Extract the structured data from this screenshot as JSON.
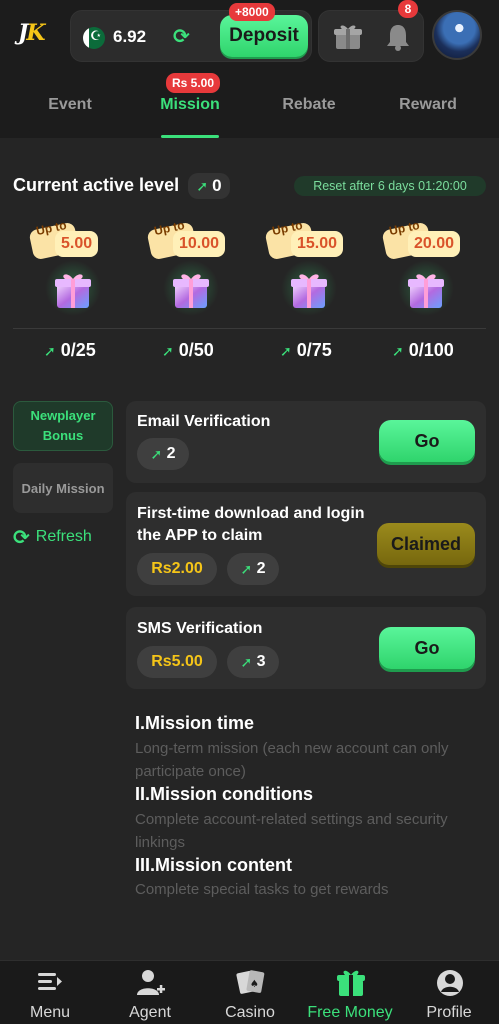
{
  "header": {
    "logo_text_j": "J",
    "logo_text_k": "K",
    "balance": "6.92",
    "deposit_label": "Deposit",
    "deposit_badge": "+8000",
    "notification_count": "8",
    "icons": [
      "pakistan-flag-icon",
      "refresh-icon",
      "gift-icon",
      "bell-icon",
      "avatar"
    ]
  },
  "tabs": {
    "items": [
      {
        "label": "Event"
      },
      {
        "label": "Mission"
      },
      {
        "label": "Rebate"
      },
      {
        "label": "Reward"
      }
    ],
    "active": "Mission",
    "mission_badge": "Rs 5.00"
  },
  "level": {
    "title": "Current active level",
    "value": "0",
    "reset_text": "Reset after 6 days 01:20:00",
    "tiers": [
      {
        "up_to": "Up to",
        "amount": "5.00",
        "progress": "0/25"
      },
      {
        "up_to": "Up to",
        "amount": "10.00",
        "progress": "0/50"
      },
      {
        "up_to": "Up to",
        "amount": "15.00",
        "progress": "0/75"
      },
      {
        "up_to": "Up to",
        "amount": "20.00",
        "progress": "0/100"
      }
    ]
  },
  "sidebar": {
    "newplayer_line1": "Newplayer",
    "newplayer_line2": "Bonus",
    "daily": "Daily Mission",
    "refresh": "Refresh"
  },
  "missions": [
    {
      "title": "Email Verification",
      "reward": "2",
      "button": "Go"
    },
    {
      "title": "First-time download and login the APP to claim",
      "money": "Rs2.00",
      "reward": "2",
      "button": "Claimed"
    },
    {
      "title": "SMS Verification",
      "money": "Rs5.00",
      "reward": "3",
      "button": "Go"
    }
  ],
  "rules": {
    "h1": "I.Mission time",
    "p1": "Long-term mission (each new account can only participate once)",
    "h2": "II.Mission conditions",
    "p2": "Complete account-related settings and security linkings",
    "h3": "III.Mission content",
    "p3": "Complete special tasks to get rewards"
  },
  "bottom_nav": {
    "items": [
      {
        "label": "Menu",
        "icon": "menu-icon"
      },
      {
        "label": "Agent",
        "icon": "agent-icon"
      },
      {
        "label": "Casino",
        "icon": "cards-icon"
      },
      {
        "label": "Free Money",
        "icon": "gift-icon"
      },
      {
        "label": "Profile",
        "icon": "profile-icon"
      }
    ],
    "active": "Free Money"
  },
  "colors": {
    "accent": "#3be07b",
    "background": "#252525",
    "badge": "#e7393b",
    "money": "#f5c518"
  }
}
